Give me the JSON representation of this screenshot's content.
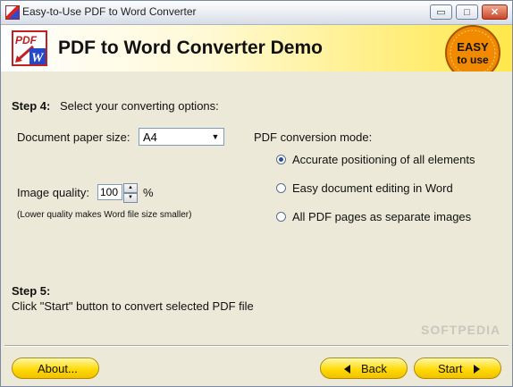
{
  "window": {
    "title": "Easy-to-Use PDF to Word Converter",
    "controls": {
      "minimize": "▭",
      "maximize": "□",
      "close": "✕"
    }
  },
  "header": {
    "title": "PDF to Word Converter Demo",
    "logo_text_top": "PDF",
    "logo_text_bottom": "W",
    "badge_line1": "EASY",
    "badge_line2": "to use"
  },
  "step4": {
    "label": "Step 4:",
    "text": "Select your converting options:",
    "paper_size_label": "Document paper size:",
    "paper_size_value": "A4",
    "image_quality_label": "Image quality:",
    "image_quality_value": "100",
    "image_quality_unit": "%",
    "image_quality_note": "(Lower quality makes Word file size smaller)",
    "conversion_mode_label": "PDF conversion mode:",
    "modes": [
      {
        "label": "Accurate positioning of all elements",
        "checked": true
      },
      {
        "label": "Easy document editing in Word",
        "checked": false
      },
      {
        "label": "All PDF pages as separate images",
        "checked": false
      }
    ]
  },
  "step5": {
    "label": "Step 5:",
    "text": "Click \"Start\" button to convert selected PDF file"
  },
  "footer": {
    "about_label": "About...",
    "back_label": "Back",
    "start_label": "Start"
  },
  "watermark": "SOFTPEDIA",
  "colors": {
    "accent_yellow": "#ffd800",
    "badge_orange": "#f28a00",
    "ribbon_blue": "#1e48c8"
  }
}
